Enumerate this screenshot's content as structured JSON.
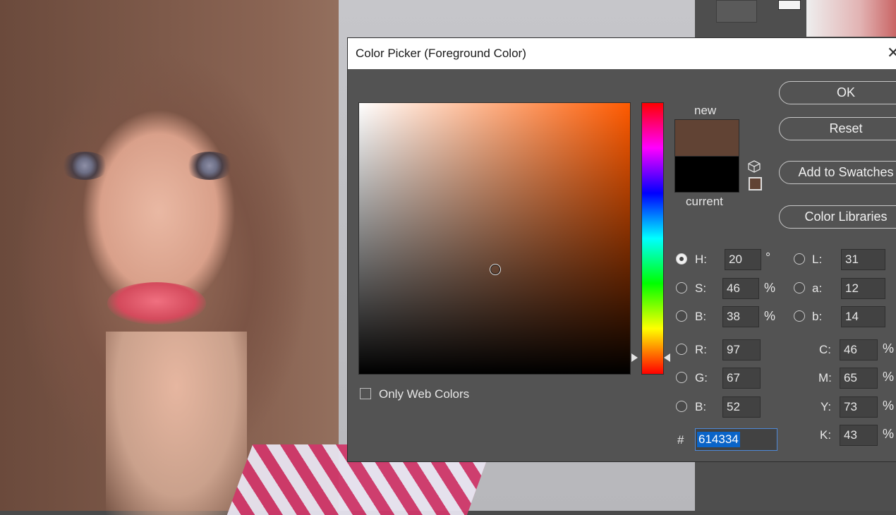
{
  "dialog": {
    "title": "Color Picker (Foreground Color)",
    "close_glyph": "✕",
    "new_label": "new",
    "current_label": "current",
    "new_color": "#614334",
    "current_color": "#000000",
    "only_web_colors_label": "Only Web Colors",
    "only_web_colors_checked": false,
    "buttons": {
      "ok": "OK",
      "reset": "Reset",
      "add_to_swatches": "Add to Swatches",
      "color_libraries": "Color Libraries"
    },
    "hsb": {
      "h_label": "H:",
      "h_value": "20",
      "h_unit": "°",
      "s_label": "S:",
      "s_value": "46",
      "s_unit": "%",
      "b_label": "B:",
      "b_value": "38",
      "b_unit": "%",
      "selected": "H"
    },
    "lab": {
      "l_label": "L:",
      "l_value": "31",
      "a_label": "a:",
      "a_value": "12",
      "b_label": "b:",
      "b_value": "14"
    },
    "rgb": {
      "r_label": "R:",
      "r_value": "97",
      "g_label": "G:",
      "g_value": "67",
      "b_label": "B:",
      "b_value": "52"
    },
    "cmyk": {
      "c_label": "C:",
      "c_value": "46",
      "c_unit": "%",
      "m_label": "M:",
      "m_value": "65",
      "m_unit": "%",
      "y_label": "Y:",
      "y_value": "73",
      "y_unit": "%",
      "k_label": "K:",
      "k_value": "43",
      "k_unit": "%"
    },
    "hex": {
      "label": "#",
      "value": "614334"
    },
    "icons": [
      "cube-icon",
      "web-safe-swatch-icon",
      "close-icon",
      "color-field-ring-icon",
      "hue-slider-arrow-icon"
    ]
  }
}
